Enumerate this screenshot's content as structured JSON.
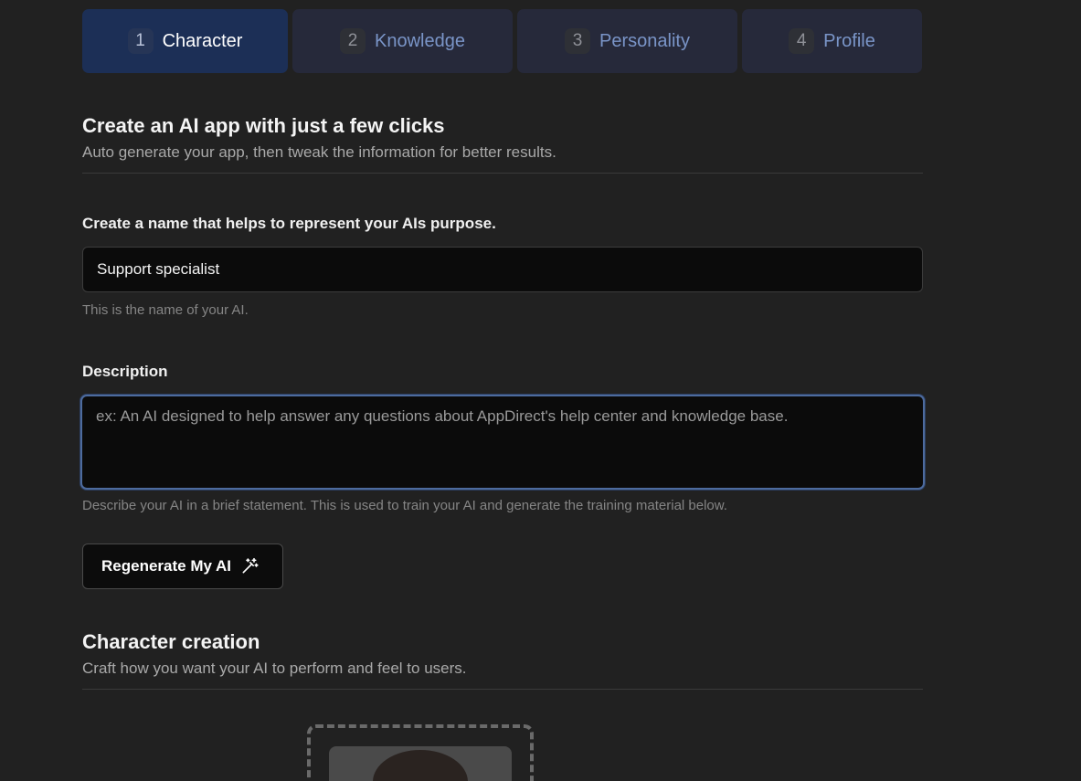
{
  "steps": [
    {
      "num": "1",
      "label": "Character",
      "active": true
    },
    {
      "num": "2",
      "label": "Knowledge",
      "active": false
    },
    {
      "num": "3",
      "label": "Personality",
      "active": false
    },
    {
      "num": "4",
      "label": "Profile",
      "active": false
    }
  ],
  "intro": {
    "title": "Create an AI app with just a few clicks",
    "subtitle": "Auto generate your app, then tweak the information for better results."
  },
  "name_field": {
    "label": "Create a name that helps to represent your AIs purpose.",
    "value": "Support specialist",
    "help": "This is the name of your AI."
  },
  "description_field": {
    "label": "Description",
    "value": "",
    "placeholder": "ex: An AI designed to help answer any questions about AppDirect's help center and knowledge base.",
    "help": "Describe your AI in a brief statement. This is used to train your AI and generate the training material below."
  },
  "regenerate_button": {
    "label": "Regenerate My AI",
    "icon": "magic-wand-icon"
  },
  "character_creation": {
    "title": "Character creation",
    "subtitle": "Craft how you want your AI to perform and feel to users."
  },
  "colors": {
    "background": "#212121",
    "active_step": "#1c2f56",
    "inactive_step": "#26293a",
    "step_text": "#7a95c8",
    "focus_border": "#4d6b9e"
  }
}
